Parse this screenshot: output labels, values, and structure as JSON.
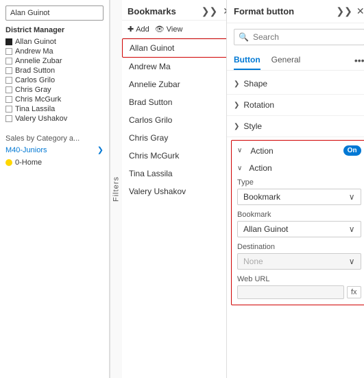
{
  "left": {
    "filter_box_label": "Alan Guinot",
    "district_label": "District Manager",
    "items": [
      {
        "name": "Allan Guinot",
        "type": "filled"
      },
      {
        "name": "Andrew Ma",
        "type": "check"
      },
      {
        "name": "Annelie Zubar",
        "type": "check"
      },
      {
        "name": "Brad Sutton",
        "type": "check"
      },
      {
        "name": "Carlos Grilo",
        "type": "check"
      },
      {
        "name": "Chris Gray",
        "type": "check"
      },
      {
        "name": "Chris McGurk",
        "type": "check"
      },
      {
        "name": "Tina Lassila",
        "type": "check"
      },
      {
        "name": "Valery Ushakov",
        "type": "check"
      }
    ],
    "sales_label": "Sales by Category a...",
    "m40_label": "M40-Juniors",
    "home_label": "0-Home"
  },
  "bookmarks": {
    "title": "Bookmarks",
    "add_label": "Add",
    "view_label": "View",
    "filters_tab": "Filters",
    "items": [
      {
        "name": "Allan Guinot",
        "selected": true
      },
      {
        "name": "Andrew Ma",
        "selected": false
      },
      {
        "name": "Annelie Zubar",
        "selected": false
      },
      {
        "name": "Brad Sutton",
        "selected": false
      },
      {
        "name": "Carlos Grilo",
        "selected": false
      },
      {
        "name": "Chris Gray",
        "selected": false
      },
      {
        "name": "Chris McGurk",
        "selected": false
      },
      {
        "name": "Tina Lassila",
        "selected": false
      },
      {
        "name": "Valery Ushakov",
        "selected": false
      }
    ]
  },
  "format": {
    "title": "Format button",
    "search_placeholder": "Search",
    "tabs": [
      {
        "label": "Button",
        "active": true
      },
      {
        "label": "General",
        "active": false
      }
    ],
    "sections": [
      {
        "label": "Shape",
        "expanded": false
      },
      {
        "label": "Rotation",
        "expanded": false
      },
      {
        "label": "Style",
        "expanded": false
      }
    ],
    "action_section": {
      "label": "Action",
      "toggle": "On",
      "inner_label": "Action",
      "type_label": "Type",
      "type_value": "Bookmark",
      "bookmark_label": "Bookmark",
      "bookmark_value": "Allan Guinot",
      "destination_label": "Destination",
      "destination_value": "None",
      "weburl_label": "Web URL",
      "weburl_placeholder": ""
    }
  }
}
